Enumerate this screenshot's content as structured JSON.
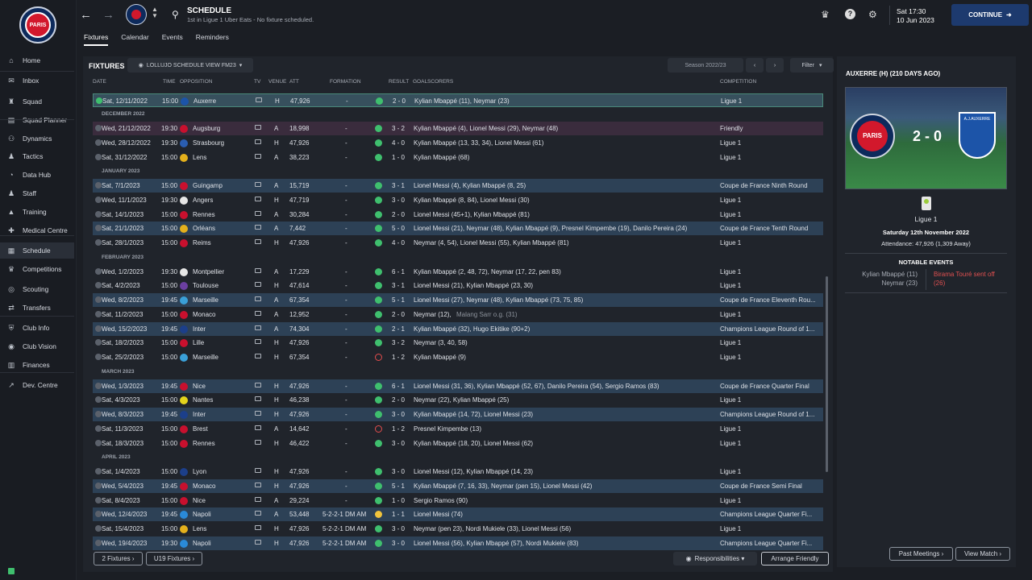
{
  "sidebar": {
    "items": [
      {
        "label": "Home",
        "icon": "home-icon"
      },
      {
        "label": "Inbox",
        "icon": "inbox-icon"
      },
      {
        "label": "Squad",
        "icon": "shirt-icon"
      },
      {
        "label": "Squad Planner",
        "icon": "planner-icon"
      },
      {
        "label": "Dynamics",
        "icon": "dynamics-icon"
      },
      {
        "label": "Tactics",
        "icon": "tactics-icon"
      },
      {
        "label": "Data Hub",
        "icon": "data-hub-icon"
      },
      {
        "label": "Staff",
        "icon": "staff-icon"
      },
      {
        "label": "Training",
        "icon": "training-icon"
      },
      {
        "label": "Medical Centre",
        "icon": "medical-icon"
      },
      {
        "label": "Schedule",
        "icon": "schedule-icon"
      },
      {
        "label": "Competitions",
        "icon": "trophy-icon"
      },
      {
        "label": "Scouting",
        "icon": "scouting-icon"
      },
      {
        "label": "Transfers",
        "icon": "transfers-icon"
      },
      {
        "label": "Club Info",
        "icon": "club-info-icon"
      },
      {
        "label": "Club Vision",
        "icon": "club-vision-icon"
      },
      {
        "label": "Finances",
        "icon": "finances-icon"
      },
      {
        "label": "Dev. Centre",
        "icon": "dev-centre-icon"
      }
    ],
    "crest_text": "PARIS"
  },
  "header": {
    "title": "SCHEDULE",
    "subtitle": "1st in Ligue 1 Uber Eats - No fixture scheduled.",
    "day_time": "Sat 17:30",
    "date": "10 Jun 2023",
    "continue": "CONTINUE"
  },
  "tabs": [
    "Fixtures",
    "Calendar",
    "Events",
    "Reminders"
  ],
  "fixtures": {
    "title": "FIXTURES",
    "view": "LOLLUJO SCHEDULE VIEW FM23",
    "season": "Season 2022/23",
    "filter": "Filter",
    "columns": [
      "DATE",
      "TIME",
      "OPPOSITION",
      "TV",
      "VENUE",
      "ATT",
      "FORMATION",
      "RESULT",
      "GOALSCORERS",
      "COMPETITION"
    ]
  },
  "rows": [
    {
      "type": "row",
      "date": "Sat, 12/11/2022",
      "time": "15:00",
      "opp": "Auxerre",
      "venue": "H",
      "att": "47,926",
      "form": "-",
      "res": "w",
      "score": "2 - 0",
      "scorers": "Kylian Mbappé (11), Neymar (23)",
      "comp": "Ligue 1",
      "style": "sel"
    },
    {
      "type": "section",
      "label": "DECEMBER 2022"
    },
    {
      "type": "row",
      "date": "Wed, 21/12/2022",
      "time": "19:30",
      "opp": "Augsburg",
      "venue": "A",
      "att": "18,998",
      "form": "-",
      "res": "w",
      "score": "3 - 2",
      "scorers": "Kylian Mbappé (4), Lionel Messi (29), Neymar (48)",
      "comp": "Friendly",
      "style": "friendly"
    },
    {
      "type": "row",
      "date": "Wed, 28/12/2022",
      "time": "19:30",
      "opp": "Strasbourg",
      "venue": "H",
      "att": "47,926",
      "form": "-",
      "res": "w",
      "score": "4 - 0",
      "scorers": "Kylian Mbappé (13, 33, 34), Lionel Messi (61)",
      "comp": "Ligue 1",
      "style": ""
    },
    {
      "type": "row",
      "date": "Sat, 31/12/2022",
      "time": "15:00",
      "opp": "Lens",
      "venue": "A",
      "att": "38,223",
      "form": "-",
      "res": "w",
      "score": "1 - 0",
      "scorers": "Kylian Mbappé (68)",
      "comp": "Ligue 1",
      "style": ""
    },
    {
      "type": "section",
      "label": "JANUARY 2023"
    },
    {
      "type": "row",
      "date": "Sat, 7/1/2023",
      "time": "15:00",
      "opp": "Guingamp",
      "venue": "A",
      "att": "15,719",
      "form": "-",
      "res": "w",
      "score": "3 - 1",
      "scorers": "Lionel Messi (4), Kylian Mbappé (8, 25)",
      "comp": "Coupe de France Ninth Round",
      "style": "hl"
    },
    {
      "type": "row",
      "date": "Wed, 11/1/2023",
      "time": "19:30",
      "opp": "Angers",
      "venue": "H",
      "att": "47,719",
      "form": "-",
      "res": "w",
      "score": "3 - 0",
      "scorers": "Kylian Mbappé (8, 84), Lionel Messi (30)",
      "comp": "Ligue 1",
      "style": ""
    },
    {
      "type": "row",
      "date": "Sat, 14/1/2023",
      "time": "15:00",
      "opp": "Rennes",
      "venue": "A",
      "att": "30,284",
      "form": "-",
      "res": "w",
      "score": "2 - 0",
      "scorers": "Lionel Messi (45+1), Kylian Mbappé (81)",
      "comp": "Ligue 1",
      "style": ""
    },
    {
      "type": "row",
      "date": "Sat, 21/1/2023",
      "time": "15:00",
      "opp": "Orléans",
      "venue": "A",
      "att": "7,442",
      "form": "-",
      "res": "w",
      "score": "5 - 0",
      "scorers": "Lionel Messi (21), Neymar (48), Kylian Mbappé (9), Presnel Kimpembe (19), Danilo Pereira (24)",
      "comp": "Coupe de France Tenth Round",
      "style": "hl"
    },
    {
      "type": "row",
      "date": "Sat, 28/1/2023",
      "time": "15:00",
      "opp": "Reims",
      "venue": "H",
      "att": "47,926",
      "form": "-",
      "res": "w",
      "score": "4 - 0",
      "scorers": "Neymar (4, 54), Lionel Messi (55), Kylian Mbappé (81)",
      "comp": "Ligue 1",
      "style": ""
    },
    {
      "type": "section",
      "label": "FEBRUARY 2023"
    },
    {
      "type": "row",
      "date": "Wed, 1/2/2023",
      "time": "19:30",
      "opp": "Montpellier",
      "venue": "A",
      "att": "17,229",
      "form": "-",
      "res": "w",
      "score": "6 - 1",
      "scorers": "Kylian Mbappé (2, 48, 72), Neymar (17, 22, pen 83)",
      "comp": "Ligue 1",
      "style": ""
    },
    {
      "type": "row",
      "date": "Sat, 4/2/2023",
      "time": "15:00",
      "opp": "Toulouse",
      "venue": "H",
      "att": "47,614",
      "form": "-",
      "res": "w",
      "score": "3 - 1",
      "scorers": "Lionel Messi (21), Kylian Mbappé (23, 30)",
      "comp": "Ligue 1",
      "style": ""
    },
    {
      "type": "row",
      "date": "Wed, 8/2/2023",
      "time": "19:45",
      "opp": "Marseille",
      "venue": "A",
      "att": "67,354",
      "form": "-",
      "res": "w",
      "score": "5 - 1",
      "scorers": "Lionel Messi (27), Neymar (48), Kylian Mbappé (73, 75, 85)",
      "comp": "Coupe de France Eleventh Rou...",
      "style": "hl"
    },
    {
      "type": "row",
      "date": "Sat, 11/2/2023",
      "time": "15:00",
      "opp": "Monaco",
      "venue": "A",
      "att": "12,952",
      "form": "-",
      "res": "w",
      "score": "2 - 0",
      "scorers": "Neymar (12), ",
      "og": "Malang Sarr o.g. (31)",
      "comp": "Ligue 1",
      "style": ""
    },
    {
      "type": "row",
      "date": "Wed, 15/2/2023",
      "time": "19:45",
      "opp": "Inter",
      "venue": "A",
      "att": "74,304",
      "form": "-",
      "res": "w",
      "score": "2 - 1",
      "scorers": "Kylian Mbappé (32), Hugo Ekitike (90+2)",
      "comp": "Champions League Round of 1...",
      "style": "hl"
    },
    {
      "type": "row",
      "date": "Sat, 18/2/2023",
      "time": "15:00",
      "opp": "Lille",
      "venue": "H",
      "att": "47,926",
      "form": "-",
      "res": "w",
      "score": "3 - 2",
      "scorers": "Neymar (3, 40, 58)",
      "comp": "Ligue 1",
      "style": ""
    },
    {
      "type": "row",
      "date": "Sat, 25/2/2023",
      "time": "15:00",
      "opp": "Marseille",
      "venue": "H",
      "att": "67,354",
      "form": "-",
      "res": "l",
      "score": "1 - 2",
      "scorers": "Kylian Mbappé (9)",
      "comp": "Ligue 1",
      "style": ""
    },
    {
      "type": "section",
      "label": "MARCH 2023"
    },
    {
      "type": "row",
      "date": "Wed, 1/3/2023",
      "time": "19:45",
      "opp": "Nice",
      "venue": "H",
      "att": "47,926",
      "form": "-",
      "res": "w",
      "score": "6 - 1",
      "scorers": "Lionel Messi (31, 36), Kylian Mbappé (52, 67), Danilo Pereira (54), Sergio Ramos (83)",
      "comp": "Coupe de France Quarter Final",
      "style": "hl"
    },
    {
      "type": "row",
      "date": "Sat, 4/3/2023",
      "time": "15:00",
      "opp": "Nantes",
      "venue": "H",
      "att": "46,238",
      "form": "-",
      "res": "w",
      "score": "2 - 0",
      "scorers": "Neymar (22), Kylian Mbappé (25)",
      "comp": "Ligue 1",
      "style": ""
    },
    {
      "type": "row",
      "date": "Wed, 8/3/2023",
      "time": "19:45",
      "opp": "Inter",
      "venue": "H",
      "att": "47,926",
      "form": "-",
      "res": "w",
      "score": "3 - 0",
      "scorers": "Kylian Mbappé (14, 72), Lionel Messi (23)",
      "comp": "Champions League Round of 1...",
      "style": "hl"
    },
    {
      "type": "row",
      "date": "Sat, 11/3/2023",
      "time": "15:00",
      "opp": "Brest",
      "venue": "A",
      "att": "14,642",
      "form": "-",
      "res": "l",
      "score": "1 - 2",
      "scorers": "Presnel Kimpembe (13)",
      "comp": "Ligue 1",
      "style": ""
    },
    {
      "type": "row",
      "date": "Sat, 18/3/2023",
      "time": "15:00",
      "opp": "Rennes",
      "venue": "H",
      "att": "46,422",
      "form": "-",
      "res": "w",
      "score": "3 - 0",
      "scorers": "Kylian Mbappé (18, 20), Lionel Messi (62)",
      "comp": "Ligue 1",
      "style": ""
    },
    {
      "type": "section",
      "label": "APRIL 2023"
    },
    {
      "type": "row",
      "date": "Sat, 1/4/2023",
      "time": "15:00",
      "opp": "Lyon",
      "venue": "H",
      "att": "47,926",
      "form": "-",
      "res": "w",
      "score": "3 - 0",
      "scorers": "Lionel Messi (12), Kylian Mbappé (14, 23)",
      "comp": "Ligue 1",
      "style": ""
    },
    {
      "type": "row",
      "date": "Wed, 5/4/2023",
      "time": "19:45",
      "opp": "Monaco",
      "venue": "H",
      "att": "47,926",
      "form": "-",
      "res": "w",
      "score": "5 - 1",
      "scorers": "Kylian Mbappé (7, 16, 33), Neymar (pen 15), Lionel Messi (42)",
      "comp": "Coupe de France Semi Final",
      "style": "hl"
    },
    {
      "type": "row",
      "date": "Sat, 8/4/2023",
      "time": "15:00",
      "opp": "Nice",
      "venue": "A",
      "att": "29,224",
      "form": "-",
      "res": "w",
      "score": "1 - 0",
      "scorers": "Sergio Ramos (90)",
      "comp": "Ligue 1",
      "style": ""
    },
    {
      "type": "row",
      "date": "Wed, 12/4/2023",
      "time": "19:45",
      "opp": "Napoli",
      "venue": "A",
      "att": "53,448",
      "form": "5-2-2-1 DM AM",
      "res": "d",
      "score": "1 - 1",
      "scorers": "Lionel Messi (74)",
      "comp": "Champions League Quarter Fi...",
      "style": "hl"
    },
    {
      "type": "row",
      "date": "Sat, 15/4/2023",
      "time": "15:00",
      "opp": "Lens",
      "venue": "H",
      "att": "47,926",
      "form": "5-2-2-1 DM AM",
      "res": "w",
      "score": "3 - 0",
      "scorers": "Neymar (pen 23), Nordi Mukiele (33), Lionel Messi (56)",
      "comp": "Ligue 1",
      "style": ""
    },
    {
      "type": "row",
      "date": "Wed, 19/4/2023",
      "time": "19:30",
      "opp": "Napoli",
      "venue": "H",
      "att": "47,926",
      "form": "5-2-2-1 DM AM",
      "res": "w",
      "score": "3 - 0",
      "scorers": "Lionel Messi (56), Kylian Mbappé (57), Nordi Mukiele (83)",
      "comp": "Champions League Quarter Fi...",
      "style": "hl"
    }
  ],
  "bottom": {
    "fixtures2": "2 Fixtures",
    "u19": "U19 Fixtures",
    "responsibilities": "Responsibilities",
    "arrange": "Arrange Friendly"
  },
  "panel": {
    "title": "AUXERRE (H) (210 DAYS AGO)",
    "home_crest": "PARIS",
    "away_crest": "A.J.AUXERRE",
    "score": "2 - 0",
    "competition": "Ligue 1",
    "date": "Saturday 12th November 2022",
    "attendance": "Attendance: 47,926 (1,309 Away)",
    "notable": "NOTABLE EVENTS",
    "home_events": [
      "Kylian Mbappé (11)",
      "Neymar (23)"
    ],
    "away_event": "Birama Touré sent off",
    "away_event_min": "(26)",
    "past": "Past Meetings",
    "view": "View Match"
  },
  "colors": {
    "win": "#3fbf6e",
    "loss": "#e34d4d",
    "draw": "#f0c33c",
    "accent": "#1d3a6e"
  }
}
